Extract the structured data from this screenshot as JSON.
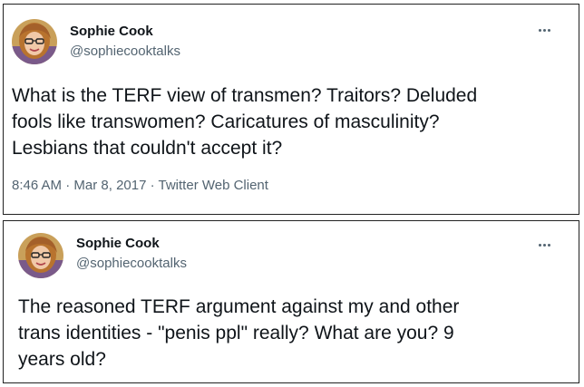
{
  "tweets": [
    {
      "author": {
        "display_name": "Sophie Cook",
        "handle": "@sophiecooktalks",
        "avatar_icon": "profile-photo"
      },
      "more_icon": "more-options-icon",
      "text": "What is the TERF view of transmen? Traitors? Deluded\nfools like transwomen? Caricatures of masculinity?\nLesbians that couldn't accept it?",
      "time": "8:46 AM",
      "date": "Mar 8, 2017",
      "source": "Twitter Web Client",
      "separator": "·"
    },
    {
      "author": {
        "display_name": "Sophie Cook",
        "handle": "@sophiecooktalks",
        "avatar_icon": "profile-photo"
      },
      "more_icon": "more-options-icon",
      "text": "The reasoned TERF argument against my and other\ntrans identities - \"penis ppl\" really? What are you? 9\nyears old?"
    }
  ],
  "colors": {
    "text_primary": "#0f1419",
    "text_secondary": "#536471",
    "border": "#222222",
    "background": "#ffffff"
  }
}
